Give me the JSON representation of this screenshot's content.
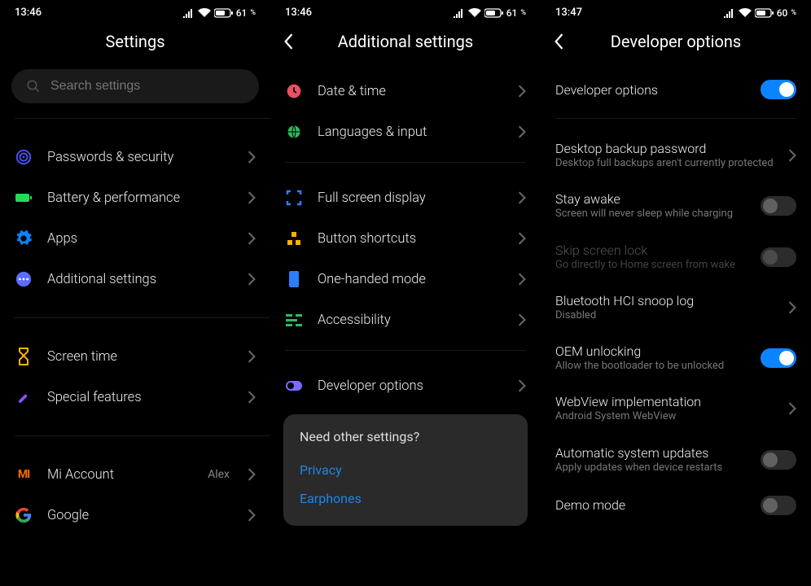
{
  "panels": [
    {
      "status": {
        "time": "13:46",
        "battery": "61"
      },
      "title": "Settings",
      "search_placeholder": "Search settings",
      "groups": [
        [
          {
            "icon": "shield-icon",
            "label": "Passwords & security"
          },
          {
            "icon": "battery-icon",
            "label": "Battery & performance"
          },
          {
            "icon": "gear-icon",
            "label": "Apps"
          },
          {
            "icon": "dots-icon",
            "label": "Additional settings"
          }
        ],
        [
          {
            "icon": "hourglass-icon",
            "label": "Screen time"
          },
          {
            "icon": "wand-icon",
            "label": "Special features"
          }
        ],
        [
          {
            "icon": "mi-icon",
            "label": "Mi Account",
            "value": "Alex"
          },
          {
            "icon": "google-icon",
            "label": "Google"
          }
        ]
      ]
    },
    {
      "status": {
        "time": "13:46",
        "battery": "61"
      },
      "title": "Additional settings",
      "groups": [
        [
          {
            "icon": "clock-icon",
            "label": "Date & time"
          },
          {
            "icon": "globe-icon",
            "label": "Languages & input"
          }
        ],
        [
          {
            "icon": "fullscreen-icon",
            "label": "Full screen display"
          },
          {
            "icon": "buttons-icon",
            "label": "Button shortcuts"
          },
          {
            "icon": "phone-icon",
            "label": "One-handed mode"
          },
          {
            "icon": "accessibility-icon",
            "label": "Accessibility"
          }
        ],
        [
          {
            "icon": "toggle-icon",
            "label": "Developer options"
          }
        ]
      ],
      "other": {
        "title": "Need other settings?",
        "links": [
          "Privacy",
          "Earphones"
        ]
      }
    },
    {
      "status": {
        "time": "13:47",
        "battery": "60"
      },
      "title": "Developer options",
      "rows": [
        {
          "title": "Developer options",
          "control": "toggle",
          "on": true
        },
        {
          "title": "Desktop backup password",
          "sub": "Desktop full backups aren't currently protected",
          "control": "chevron"
        },
        {
          "title": "Stay awake",
          "sub": "Screen will never sleep while charging",
          "control": "toggle",
          "on": false
        },
        {
          "title": "Skip screen lock",
          "sub": "Go directly to Home screen from wake",
          "control": "toggle",
          "on": false,
          "disabled": true
        },
        {
          "title": "Bluetooth HCI snoop log",
          "sub": "Disabled",
          "control": "chevron"
        },
        {
          "title": "OEM unlocking",
          "sub": "Allow the bootloader to be unlocked",
          "control": "toggle",
          "on": true
        },
        {
          "title": "WebView implementation",
          "sub": "Android System WebView",
          "control": "chevron"
        },
        {
          "title": "Automatic system updates",
          "sub": "Apply updates when device restarts",
          "control": "toggle",
          "on": false
        },
        {
          "title": "Demo mode",
          "control": "toggle",
          "on": false
        }
      ]
    }
  ]
}
